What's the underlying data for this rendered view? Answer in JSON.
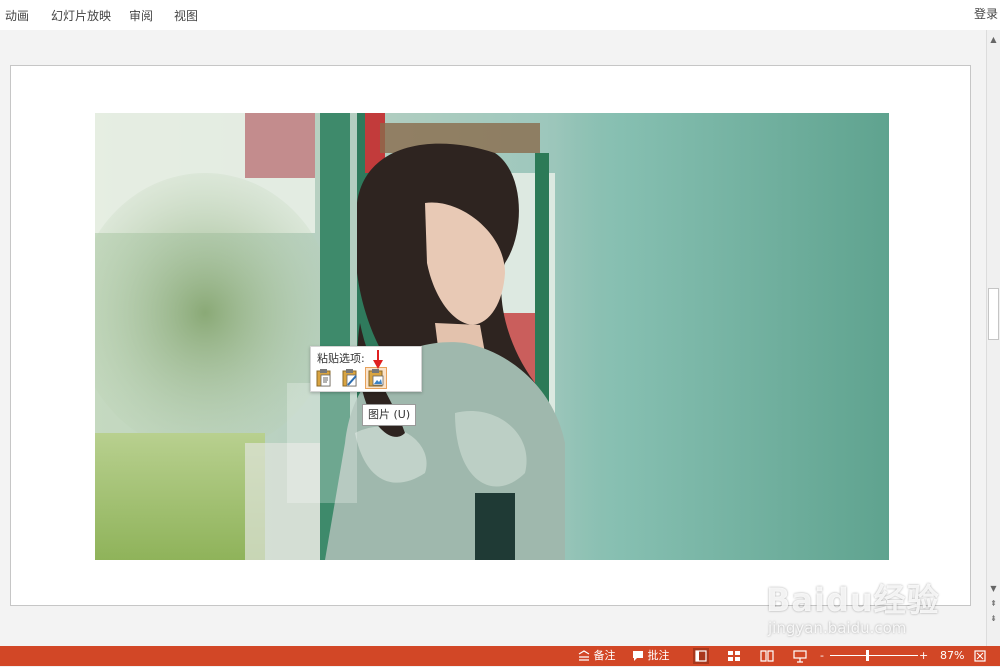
{
  "ribbon": {
    "tabs": [
      {
        "label": "动画"
      },
      {
        "label": "幻灯片放映"
      },
      {
        "label": "审阅"
      },
      {
        "label": "视图"
      }
    ],
    "signin_label": "登录"
  },
  "paste_options": {
    "title": "粘贴选项:",
    "buttons": [
      {
        "icon": "paste-keep-source-icon"
      },
      {
        "icon": "paste-destination-theme-icon"
      },
      {
        "icon": "paste-picture-icon",
        "active": true
      }
    ],
    "tooltip": "图片 (U)"
  },
  "status_bar": {
    "notes_label": "备注",
    "comments_label": "批注",
    "zoom_percent": "87%",
    "zoom_minus": "-",
    "zoom_plus": "+",
    "accent_color": "#d24726"
  },
  "watermark": {
    "logo": "Baidu经验",
    "url": "jingyan.baidu.com"
  }
}
